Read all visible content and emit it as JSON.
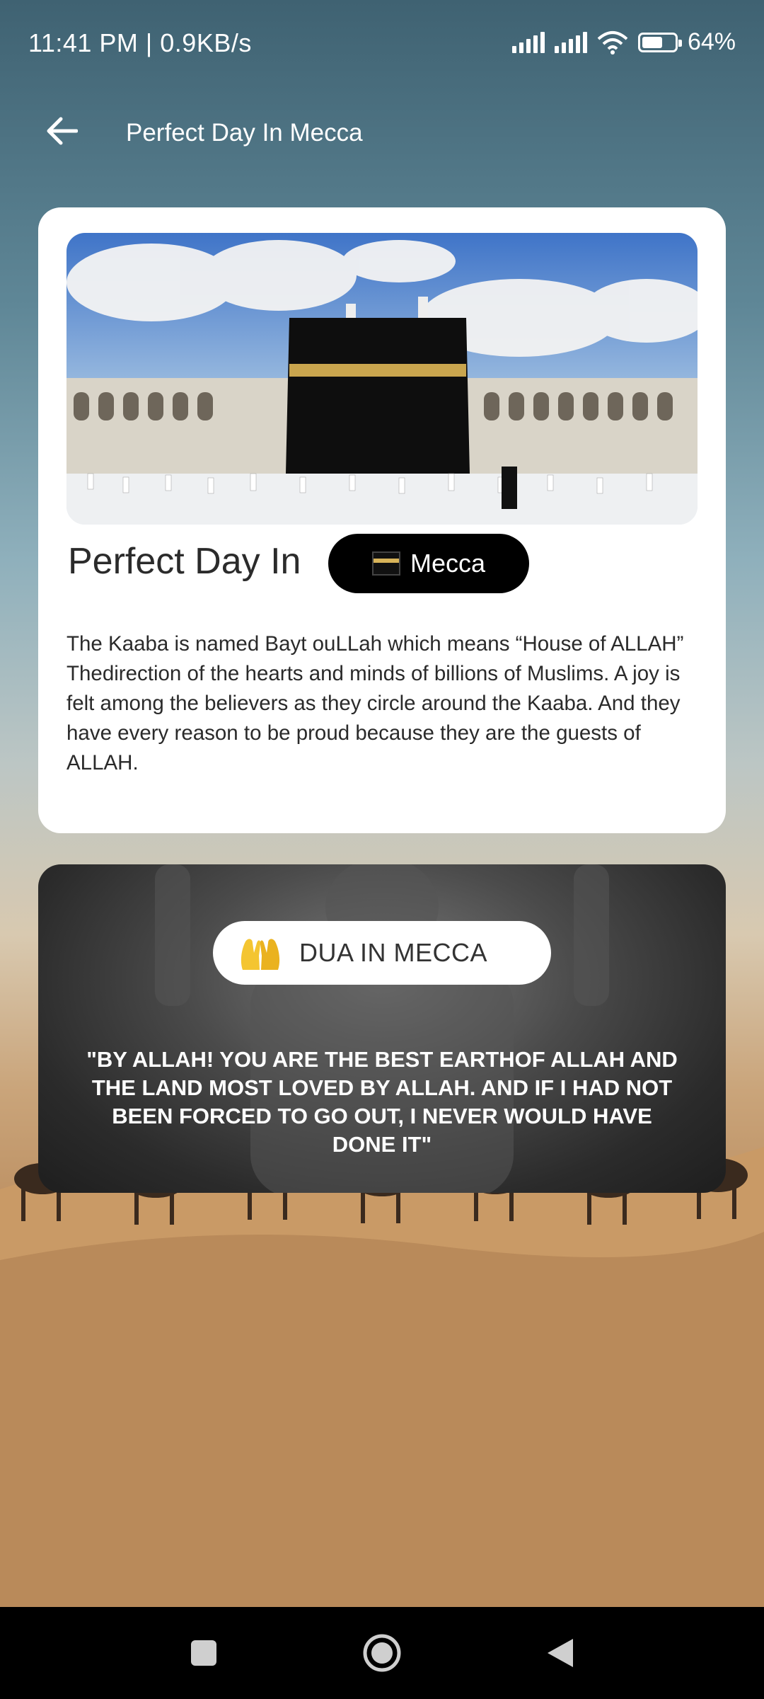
{
  "status_bar": {
    "time_speed": "11:41 PM | 0.9KB/s",
    "battery_percent": 64,
    "battery_label": "64%"
  },
  "header": {
    "title": "Perfect Day In Mecca",
    "back_icon": "arrow-left-icon"
  },
  "info_card": {
    "heading": "Perfect Day In",
    "city_button_label": "Mecca",
    "city_button_icon": "kaaba-icon",
    "description": "The Kaaba is named Bayt ouLLah which means “House of ALLAH” Thedirection of the hearts and minds of billions of Muslims. A joy is felt among the believers as they circle around the Kaaba. And they have every reason to be proud because they are the guests of ALLAH."
  },
  "dua_card": {
    "button_label": "DUA IN MECCA",
    "button_icon": "praying-hands-icon",
    "quote": "\"BY ALLAH! YOU ARE THE BEST  EARTHOF ALLAH AND THE LAND MOST LOVED BY ALLAH.  AND IF I HAD NOT BEEN FORCED TO GO OUT, I NEVER  WOULD HAVE DONE IT\""
  },
  "nav_bar": {
    "buttons": [
      "square-icon",
      "home-circle-icon",
      "back-triangle-icon"
    ]
  },
  "colors": {
    "card_bg": "#ffffff",
    "pill_bg": "#000000",
    "nav_bg": "#000000",
    "text_dark": "#2a2a2a",
    "gold": "#d8b45a"
  }
}
